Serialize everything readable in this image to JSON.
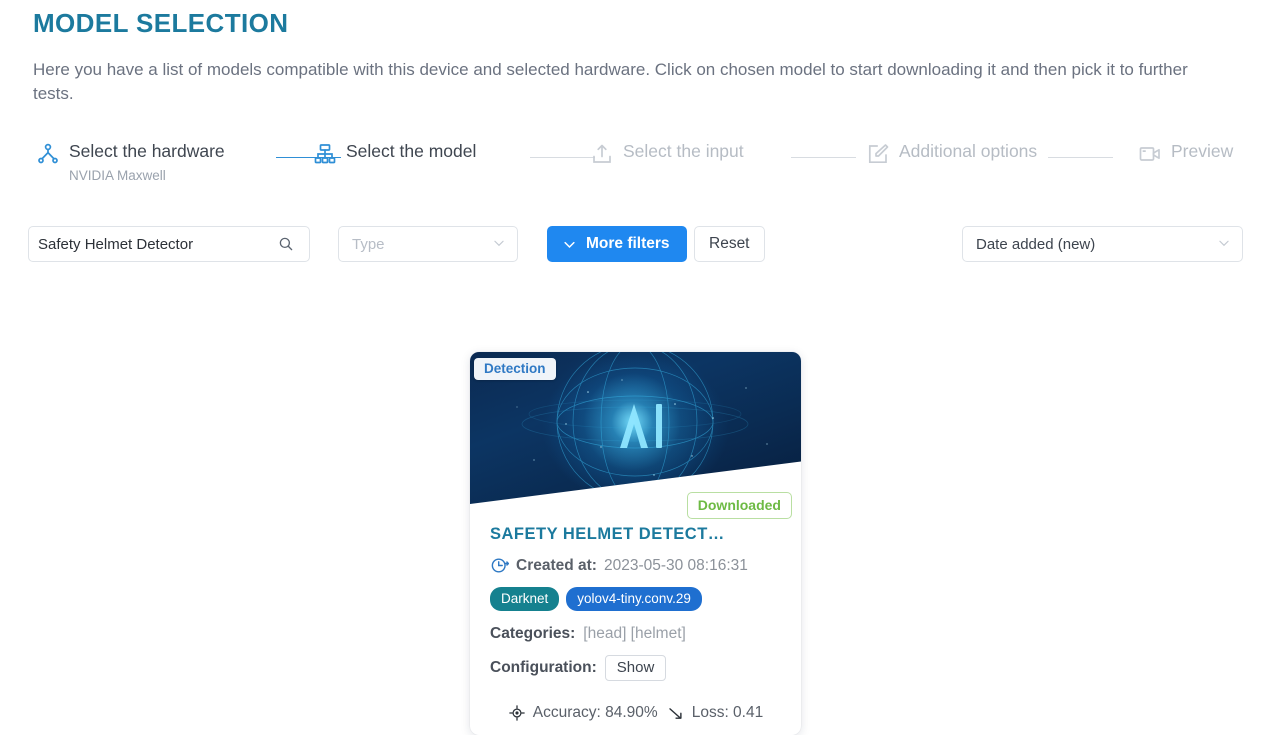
{
  "header": {
    "title": "MODEL SELECTION",
    "description": "Here you have a list of models compatible with this device and selected hardware. Click on chosen model to start downloading it and then pick it to further tests.",
    "title_color": "#1c7a9e"
  },
  "stepper": {
    "steps": [
      {
        "label": "Select the hardware",
        "sublabel": "NVIDIA Maxwell",
        "icon": "hierarchy-icon",
        "state": "active"
      },
      {
        "label": "Select the model",
        "sublabel": "",
        "icon": "sitemap-icon",
        "state": "active"
      },
      {
        "label": "Select the input",
        "sublabel": "",
        "icon": "upload-icon",
        "state": "inactive"
      },
      {
        "label": "Additional options",
        "sublabel": "",
        "icon": "edit-square-icon",
        "state": "inactive"
      },
      {
        "label": "Preview",
        "sublabel": "",
        "icon": "video-camera-icon",
        "state": "inactive"
      }
    ],
    "active_line_color": "#2f8fd6",
    "inactive_line_color": "#d8dce1"
  },
  "filters": {
    "search": {
      "value": "Safety Helmet Detector",
      "placeholder": "Search",
      "icon": "search-icon"
    },
    "type_select": {
      "value": "Type",
      "icon": "chevron-down-icon"
    },
    "more_filters_button": {
      "label": "More filters",
      "icon": "chevron-down-icon",
      "color": "#1f88f0"
    },
    "reset_button": {
      "label": "Reset"
    },
    "sort_select": {
      "value": "Date added (new)",
      "icon": "chevron-down-icon"
    }
  },
  "model_card": {
    "type_badge": "Detection",
    "status_badge": "Downloaded",
    "status_badge_color": "#6dba44",
    "title": "SAFETY HELMET DETECT…",
    "created_label": "Created at:",
    "created_value": "2023-05-30 08:16:31",
    "tags": [
      {
        "label": "Darknet",
        "color": "#15818f"
      },
      {
        "label": "yolov4-tiny.conv.29",
        "color": "#1f6fd0"
      }
    ],
    "categories_label": "Categories:",
    "categories_value": "[head]  [helmet]",
    "configuration_label": "Configuration:",
    "configuration_button": "Show",
    "accuracy_label": "Accuracy: 84.90%",
    "loss_label": "Loss: 0.41"
  }
}
